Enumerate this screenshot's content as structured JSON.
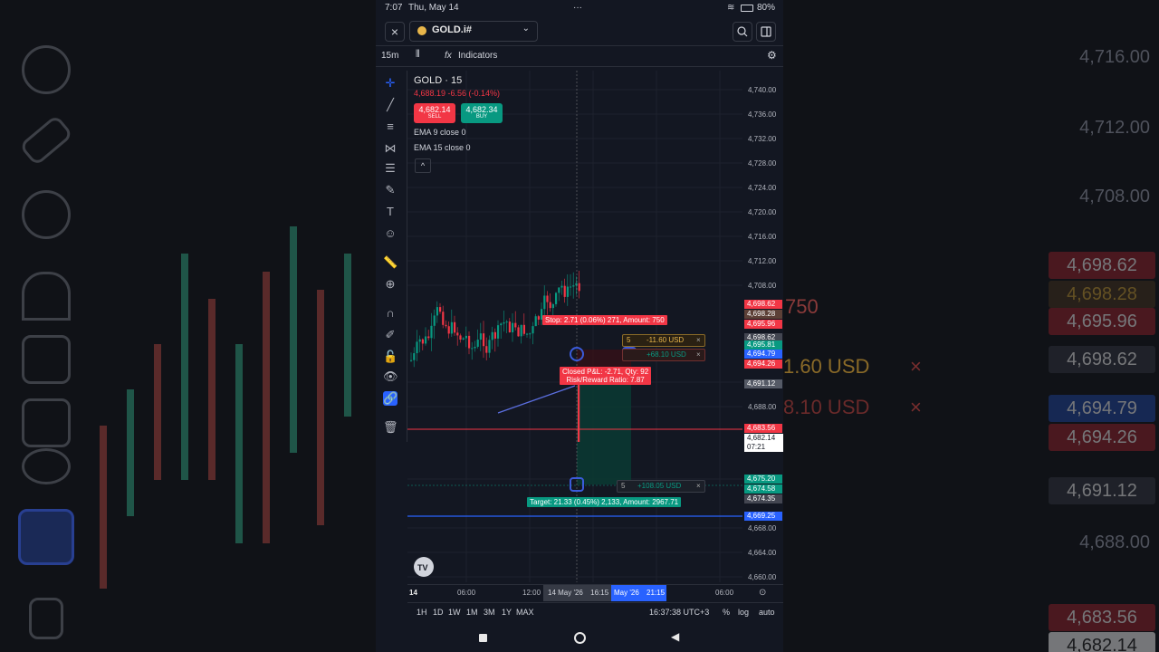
{
  "status_bar": {
    "time": "7:07",
    "date": "Thu, May 14",
    "dots": "···",
    "battery": "80%"
  },
  "header": {
    "close_glyph": "×",
    "symbol": "GOLD.i#",
    "chevron": "⌄"
  },
  "toolbar": {
    "interval": "15m",
    "indicators_label": "Indicators",
    "fx_glyph": "fx"
  },
  "legend": {
    "title": "GOLD · 15",
    "change": "4,688.19 -6.56 (-0.14%)",
    "sell": {
      "price": "4,682.14",
      "label": "SELL"
    },
    "buy": {
      "price": "4,682.34",
      "label": "BUY"
    },
    "ema1": "EMA 9 close 0",
    "ema2": "EMA 15 close 0",
    "collapse_glyph": "^"
  },
  "price_axis": [
    "4,740.00",
    "4,736.00",
    "4,732.00",
    "4,728.00",
    "4,724.00",
    "4,720.00",
    "4,716.00",
    "4,712.00",
    "4,708.00",
    "4,692.00",
    "4,688.00",
    "4,676.00",
    "4,668.00",
    "4,664.00",
    "4,660.00"
  ],
  "price_tags": [
    {
      "text": "4,698.62",
      "color": "#f23645"
    },
    {
      "text": "4,698.28",
      "color": "#5d4037"
    },
    {
      "text": "4,695.96",
      "color": "#f23645"
    },
    {
      "text": "4,698.62",
      "color": "#434651"
    },
    {
      "text": "4,695.81",
      "color": "#089981"
    },
    {
      "text": "4,694.79",
      "color": "#2962ff"
    },
    {
      "text": "4,694.26",
      "color": "#f23645"
    },
    {
      "text": "4,691.12",
      "color": "#555a66"
    },
    {
      "text": "4,683.56",
      "color": "#f23645"
    },
    {
      "text": "4,675.20",
      "color": "#089981"
    },
    {
      "text": "4,674.58",
      "color": "#089981"
    },
    {
      "text": "4,674.35",
      "color": "#434651"
    },
    {
      "text": "4,669.25",
      "color": "#2962ff"
    }
  ],
  "current_price": {
    "price": "4,682.14",
    "countdown": "07:21"
  },
  "trade_labels": {
    "stop": "Stop: 2.71 (0.06%) 271, Amount: 750",
    "closed": "Closed P&L: -2.71, Qty: 92",
    "rr": "Risk/Reward Ratio: 7.87",
    "target": "Target: 21.33 (0.45%) 2,133, Amount: 2967.71"
  },
  "position_chips": [
    {
      "qty": "5",
      "pnl": "-11.60 USD",
      "close": "×"
    },
    {
      "qty": "",
      "pnl": "+68.10 USD",
      "close": "×"
    },
    {
      "qty": "5",
      "pnl": "+108.05 USD",
      "close": "×"
    }
  ],
  "time_axis": {
    "t1": "14",
    "t2": "06:00",
    "t3": "12:00",
    "t4": "14 May '26",
    "t5": "16:15",
    "t6": "May '26",
    "t7": "21:15",
    "t8": "06:00"
  },
  "range_bar": {
    "r1": "1H",
    "r2": "1D",
    "r3": "1W",
    "r4": "1M",
    "r5": "3M",
    "r6": "1Y",
    "r7": "MAX",
    "clock": "16:37:38 UTC+3",
    "percent": "%",
    "log": "log",
    "auto": "auto"
  },
  "bg_right": {
    "p1": "4,716.00",
    "p2": "4,712.00",
    "p3": "4,708.00",
    "p4": "4,688.00",
    "t1": "4,698.62",
    "t2": "4,698.28",
    "t3": "4,695.96",
    "t4": "4,698.62",
    "t5": "4,694.79",
    "t6": "4,694.26",
    "t7": "4,691.12",
    "t8": "4,683.56",
    "t9": "4,682.14",
    "b1": "1.60 USD",
    "b2": "8.10 USD",
    "b3": "750",
    "x": "×"
  },
  "colors": {
    "bull": "#089981",
    "bear": "#f23645",
    "accent": "#2962ff",
    "bg": "#131722"
  }
}
